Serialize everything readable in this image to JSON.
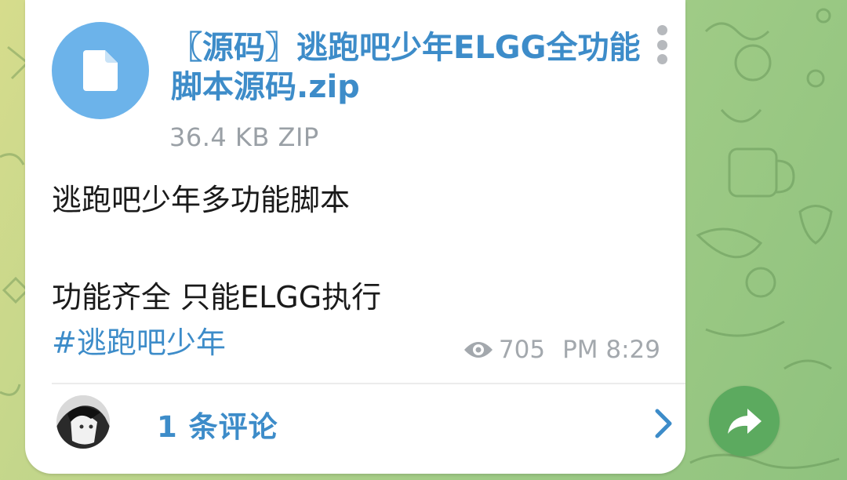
{
  "message": {
    "file": {
      "name": "〖源码〗逃跑吧少年ELGG全功能脚本源码.zip",
      "meta": "36.4 KB ZIP",
      "icon": "document-icon"
    },
    "lines": [
      "逃跑吧少年多功能脚本",
      "功能齐全 只能ELGG执行"
    ],
    "hashtag": "#逃跑吧少年",
    "views": "705",
    "time": "PM 8:29"
  },
  "comments": {
    "label": "1 条评论"
  },
  "colors": {
    "accent": "#3d8cc9",
    "file_icon_bg": "#6cb3ea",
    "forward_bg": "#5caa5f",
    "meta_text": "#a3a8ad"
  }
}
